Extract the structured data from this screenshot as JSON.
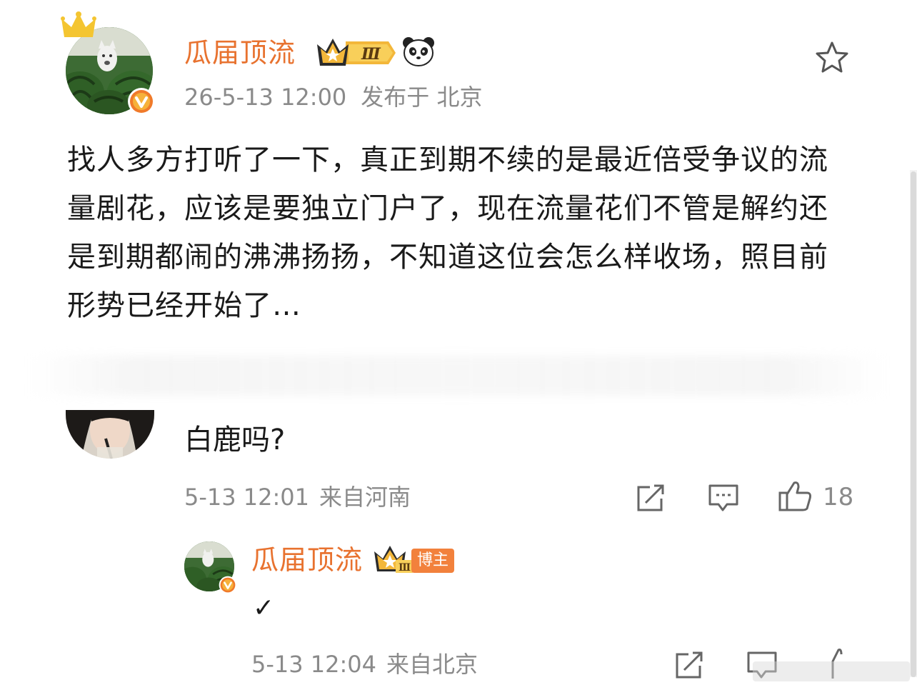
{
  "post": {
    "username": "瓜届顶流",
    "level_badge": "Ⅲ",
    "timestamp": "26-5-13 12:00",
    "location": "发布于 北京",
    "body": "找人多方打听了一下，真正到期不续的是最近倍受争议的流量剧花，应该是要独立门户了，现在流量花们不管是解约还是到期都闹的沸沸扬扬，不知道这位会怎么样收场，照目前形势已经开始了…",
    "avatar_icon": "watermelon-cat-avatar",
    "favorite_icon": "star-outline-icon"
  },
  "comment": {
    "text": "白鹿吗?",
    "timestamp": "5-13 12:01",
    "location": "来自河南",
    "like_count": "18"
  },
  "reply": {
    "username": "瓜届顶流",
    "level_badge": "Ⅲ",
    "blogger_label": "博主",
    "text": "✓",
    "timestamp": "5-13 12:04",
    "location": "来自北京"
  },
  "colors": {
    "username": "#e8722f",
    "meta": "#8a8a8a",
    "blogger_badge": "#f2813c",
    "verified": "#f07a2a",
    "gold": "#f2b731"
  }
}
